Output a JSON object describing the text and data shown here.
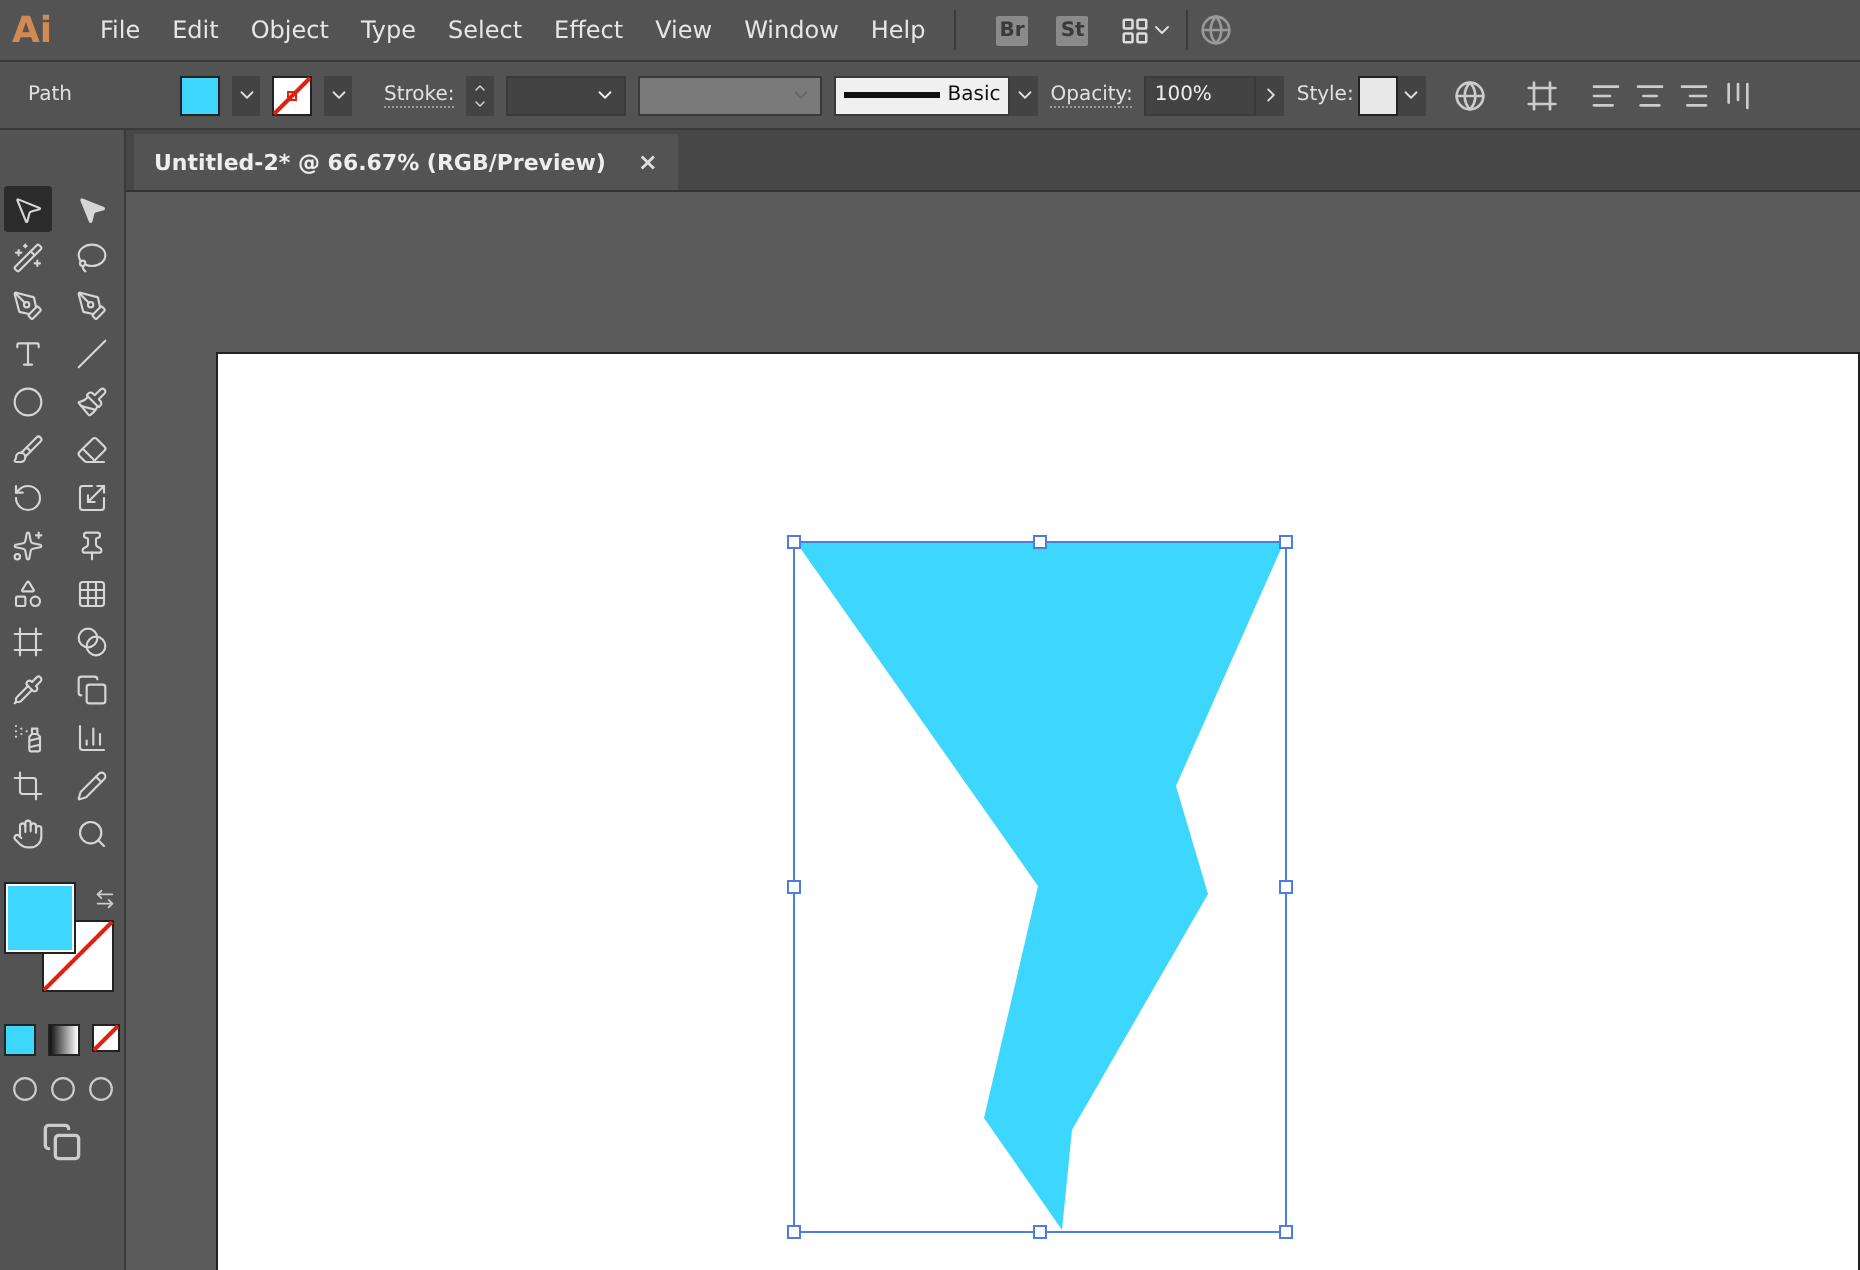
{
  "app": {
    "logo": "Ai"
  },
  "menu": [
    "File",
    "Edit",
    "Object",
    "Type",
    "Select",
    "Effect",
    "View",
    "Window",
    "Help"
  ],
  "app_buttons": [
    "Br",
    "St"
  ],
  "control_bar": {
    "selection_label": "Path",
    "stroke_label": "Stroke:",
    "brush": "Basic",
    "opacity_label": "Opacity:",
    "opacity": "100%",
    "style_label": "Style:"
  },
  "document_tab": {
    "title": "Untitled-2* @ 66.67% (RGB/Preview)",
    "close": "×"
  },
  "tools": [
    {
      "selected": true
    },
    {
      "selected": false
    },
    {
      "selected": false
    },
    {
      "selected": false
    },
    {
      "selected": false
    },
    {
      "selected": false
    },
    {
      "selected": false
    },
    {
      "selected": false
    },
    {
      "selected": false
    },
    {
      "selected": false
    },
    {
      "selected": false
    },
    {
      "selected": false
    },
    {
      "selected": false
    },
    {
      "selected": false
    },
    {
      "selected": false
    },
    {
      "selected": false
    },
    {
      "selected": false
    },
    {
      "selected": false
    },
    {
      "selected": false
    },
    {
      "selected": false
    },
    {
      "selected": false
    },
    {
      "selected": false
    },
    {
      "selected": false
    },
    {
      "selected": false
    },
    {
      "selected": false
    },
    {
      "selected": false
    },
    {
      "selected": false
    },
    {
      "selected": false
    }
  ],
  "fill_swatch": {
    "color": "#3dd7fd"
  },
  "shape": {
    "color": "#3dd7fd",
    "selected": true
  }
}
